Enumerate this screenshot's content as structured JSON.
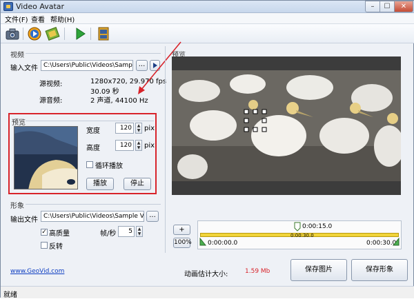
{
  "window": {
    "title": "Video Avatar",
    "minimize": "–",
    "maximize": "☐",
    "close": "✕"
  },
  "menu": {
    "file": "文件(F)",
    "view": "查看",
    "help": "帮助(H)"
  },
  "toolbar": {
    "buttons": [
      {
        "name": "camera-icon"
      },
      {
        "name": "media-player-icon"
      },
      {
        "name": "film-icon"
      },
      {
        "name": "play-icon"
      },
      {
        "name": "filmstrip-icon"
      }
    ]
  },
  "video_section": {
    "title": "视频",
    "input_label": "输入文件",
    "input_value": "C:\\Users\\Public\\Videos\\Sample Videos\\",
    "browse_label": "...",
    "source_video_label": "源视频:",
    "source_video_value": "1280x720, 29.970 fps",
    "source_duration": "30.09 秒",
    "source_audio_label": "源音频:",
    "source_audio_value": "2 声道, 44100 Hz"
  },
  "preview_section": {
    "title": "预览",
    "width_label": "宽度",
    "width_value": "120",
    "width_unit": "pix",
    "height_label": "高度",
    "height_value": "120",
    "height_unit": "pix",
    "loop_label": "循环播放",
    "play_label": "播放",
    "stop_label": "停止"
  },
  "shape_section": {
    "title": "形象",
    "output_label": "输出文件",
    "output_value": "C:\\Users\\Public\\Videos\\Sample Videos\\Wild",
    "browse_label": "...",
    "hq_label": "高质量",
    "fps_label": "帧/秒",
    "fps_value": "5",
    "reverse_label": "反转"
  },
  "player": {
    "title": "预览",
    "zoom_plus": "+",
    "zoom_value": "100%",
    "marker_time": "0:00:15.0",
    "mid_time": "0:00:30.0",
    "start_time": "0:00:00.0",
    "end_time": "0:00:30.0"
  },
  "footer": {
    "website": "www.GeoVid.com",
    "size_label": "动画估计大小:",
    "size_value": "1.59 Mb",
    "save_image_label": "保存图片",
    "save_avatar_label": "保存形象",
    "status": "就绪"
  },
  "colors": {
    "accent_red": "#d8232a",
    "timeline_yellow": "#f1d43a",
    "size_text": "#d8232a"
  }
}
